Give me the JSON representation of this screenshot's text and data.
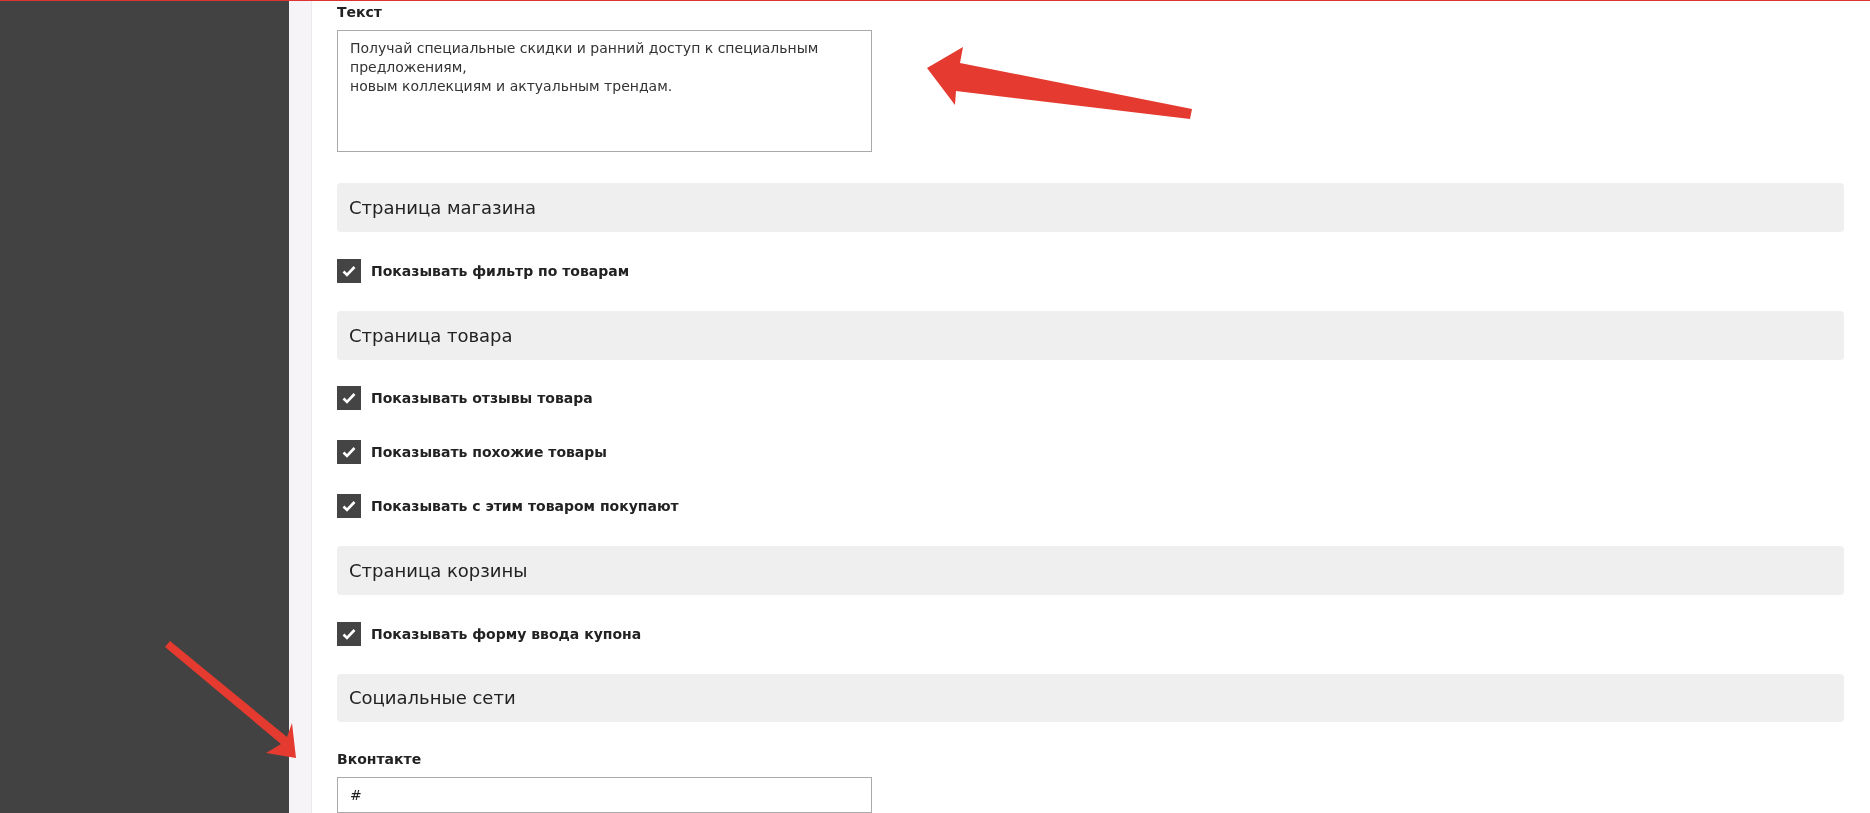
{
  "text_field": {
    "label": "Текст",
    "value": "Получай специальные скидки и ранний доступ к специальным предложениям,\nновым коллекциям и актуальным трендам."
  },
  "sections": [
    {
      "title": "Страница магазина",
      "options": [
        {
          "label": "Показывать фильтр по товарам",
          "checked": true
        }
      ]
    },
    {
      "title": "Страница товара",
      "options": [
        {
          "label": "Показывать отзывы товара",
          "checked": true
        },
        {
          "label": "Показывать похожие товары",
          "checked": true
        },
        {
          "label": "Показывать с этим товаром покупают",
          "checked": true
        }
      ]
    },
    {
      "title": "Страница корзины",
      "options": [
        {
          "label": "Показывать форму ввода купона",
          "checked": true
        }
      ]
    },
    {
      "title": "Социальные сети",
      "fields": [
        {
          "label": "Вконтакте",
          "value": "#"
        }
      ]
    }
  ]
}
